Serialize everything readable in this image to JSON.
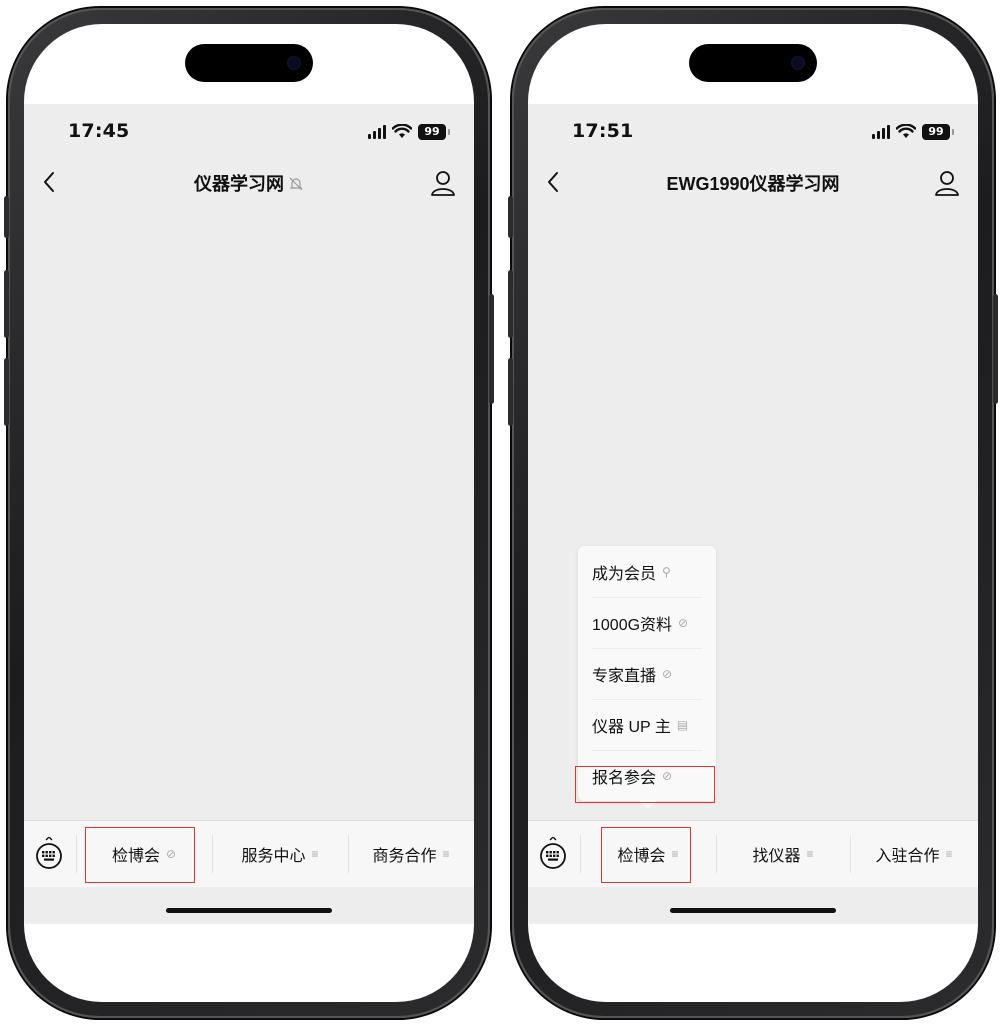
{
  "screens": [
    {
      "status": {
        "time": "17:45",
        "battery": "99"
      },
      "nav": {
        "title": "仪器学习网",
        "muted": true
      },
      "menu": [
        {
          "label": "检博会",
          "suffix": "⊘",
          "highlighted": true
        },
        {
          "label": "服务中心",
          "suffix": "≡"
        },
        {
          "label": "商务合作",
          "suffix": "≡"
        }
      ]
    },
    {
      "status": {
        "time": "17:51",
        "battery": "99"
      },
      "nav": {
        "title": "EWG1990仪器学习网"
      },
      "menu": [
        {
          "label": "检博会",
          "suffix": "≡",
          "highlighted": true
        },
        {
          "label": "找仪器",
          "suffix": "≡"
        },
        {
          "label": "入驻合作",
          "suffix": "≡"
        }
      ],
      "popup": {
        "items": [
          {
            "label": "成为会员",
            "suffix": "⚲"
          },
          {
            "label": "1000G资料",
            "suffix": "⊘"
          },
          {
            "label": "专家直播",
            "suffix": "⊘"
          },
          {
            "label": "仪器 UP 主",
            "suffix": "▤"
          },
          {
            "label": "报名参会",
            "suffix": "⊘",
            "highlighted": true
          }
        ]
      }
    }
  ],
  "colors": {
    "highlight": "#e03434",
    "app_background": "#ededed",
    "menu_background": "#f7f7f7"
  },
  "icons": [
    "back-icon",
    "person-icon",
    "bell-muted-icon",
    "keyboard-icon",
    "signal-icon",
    "wifi-icon",
    "battery-icon"
  ]
}
